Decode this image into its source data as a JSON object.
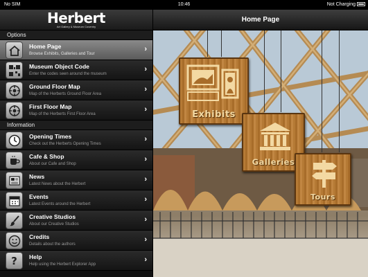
{
  "status": {
    "carrier": "No SIM",
    "time": "10:46",
    "battery_text": "Not Charging"
  },
  "sidebar": {
    "logo_title": "Herbert",
    "logo_subtitle": "Art Gallery & Museum Coventry",
    "sections": [
      {
        "title": "Options",
        "items": [
          {
            "title": "Home Page",
            "subtitle": "Browse Exhibits, Galleries and Tour",
            "icon": "house-icon",
            "selected": true
          },
          {
            "title": "Museum Object Code",
            "subtitle": "Enter the codes seen around the museum",
            "icon": "qr-code-icon"
          },
          {
            "title": "Ground Floor Map",
            "subtitle": "Map of the Herberts Ground Floor Area",
            "icon": "map-pin-icon"
          },
          {
            "title": "First Floor Map",
            "subtitle": "Map of the Herberts First Floor Area",
            "icon": "map-pin-icon"
          }
        ]
      },
      {
        "title": "Information",
        "items": [
          {
            "title": "Opening Times",
            "subtitle": "Check out the Herberts Opening Times",
            "icon": "clock-icon"
          },
          {
            "title": "Cafe & Shop",
            "subtitle": "About our Cafe and Shop",
            "icon": "coffee-cup-icon"
          },
          {
            "title": "News",
            "subtitle": "Latest News about the Herbert",
            "icon": "newspaper-icon"
          },
          {
            "title": "Events",
            "subtitle": "Latest Events around the Herbert",
            "icon": "calendar-icon"
          },
          {
            "title": "Creative Studios",
            "subtitle": "About our Creative Studios",
            "icon": "paint-brush-icon"
          },
          {
            "title": "Credits",
            "subtitle": "Details about the authors",
            "icon": "smiley-icon"
          },
          {
            "title": "Help",
            "subtitle": "Help using the Herbert Explorer App",
            "icon": "question-mark-icon"
          }
        ]
      }
    ]
  },
  "main": {
    "title": "Home Page",
    "signs": [
      {
        "label": "Exhibits",
        "icon": "pictures-icon"
      },
      {
        "label": "Galleries",
        "icon": "museum-building-icon"
      },
      {
        "label": "Tours",
        "icon": "signpost-icon"
      }
    ]
  }
}
